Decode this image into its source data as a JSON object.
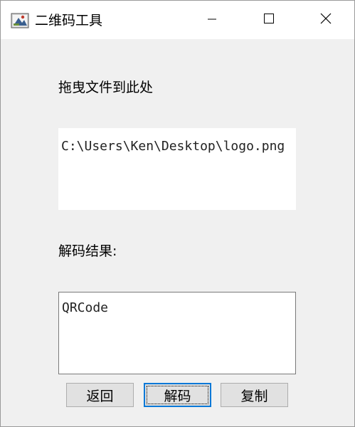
{
  "window": {
    "title": "二维码工具",
    "icons": {
      "app": "qr-tool-app-icon",
      "minimize": "minimize-icon",
      "maximize": "maximize-icon",
      "close": "close-icon"
    }
  },
  "drop": {
    "label": "拖曳文件到此处",
    "path": "C:\\Users\\Ken\\Desktop\\logo.png"
  },
  "result": {
    "label": "解码结果:",
    "value": "QRCode"
  },
  "buttons": {
    "back": "返回",
    "decode": "解码",
    "copy": "复制"
  },
  "colors": {
    "focus_accent": "#0078d7",
    "window_bg": "#f0f0f0"
  }
}
